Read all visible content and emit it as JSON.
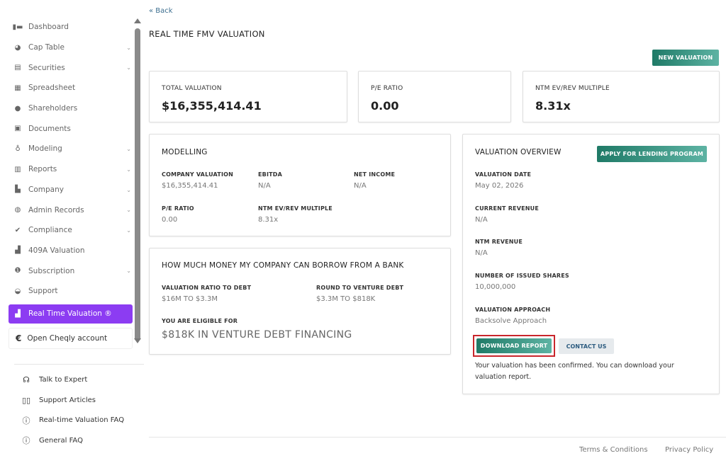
{
  "sidebar": {
    "items": [
      {
        "label": "Dashboard",
        "icon": "dashboard-icon",
        "chevron": false
      },
      {
        "label": "Cap Table",
        "icon": "pie-chart-icon",
        "chevron": true
      },
      {
        "label": "Securities",
        "icon": "clipboard-icon",
        "chevron": true
      },
      {
        "label": "Spreadsheet",
        "icon": "spreadsheet-icon",
        "chevron": false
      },
      {
        "label": "Shareholders",
        "icon": "person-icon",
        "chevron": false
      },
      {
        "label": "Documents",
        "icon": "folder-icon",
        "chevron": false
      },
      {
        "label": "Modeling",
        "icon": "lightbulb-icon",
        "chevron": true
      },
      {
        "label": "Reports",
        "icon": "report-icon",
        "chevron": true
      },
      {
        "label": "Company",
        "icon": "building-icon",
        "chevron": true
      },
      {
        "label": "Admin Records",
        "icon": "records-icon",
        "chevron": true
      },
      {
        "label": "Compliance",
        "icon": "check-badge-icon",
        "chevron": true
      },
      {
        "label": "409A Valuation",
        "icon": "bar-chart-icon",
        "chevron": false
      },
      {
        "label": "Subscription",
        "icon": "dollar-icon",
        "chevron": true
      },
      {
        "label": "Support",
        "icon": "support-icon",
        "chevron": false
      }
    ],
    "active_item": {
      "label": "Real Time Valuation ®",
      "icon": "bar-chart-icon"
    },
    "open_account": {
      "label": "Open Cheqly account",
      "icon": "cheqly-logo-icon"
    },
    "help": [
      {
        "label": "Talk to Expert",
        "icon": "headset-icon"
      },
      {
        "label": "Support Articles",
        "icon": "book-icon"
      },
      {
        "label": "Real-time Valuation FAQ",
        "icon": "question-icon"
      },
      {
        "label": "General FAQ",
        "icon": "question-icon"
      }
    ]
  },
  "main": {
    "back_label": "« Back",
    "page_title": "REAL TIME FMV VALUATION",
    "new_valuation_label": "NEW VALUATION",
    "stats": [
      {
        "label": "TOTAL VALUATION",
        "value": "$16,355,414.41"
      },
      {
        "label": "P/E RATIO",
        "value": "0.00"
      },
      {
        "label": "NTM EV/REV MULTIPLE",
        "value": "8.31x"
      }
    ],
    "modelling": {
      "title": "MODELLING",
      "fields": [
        {
          "label": "COMPANY VALUATION",
          "value": "$16,355,414.41"
        },
        {
          "label": "EBITDA",
          "value": "N/A"
        },
        {
          "label": "NET INCOME",
          "value": "N/A"
        },
        {
          "label": "P/E RATIO",
          "value": "0.00"
        },
        {
          "label": "NTM EV/REV MULTIPLE",
          "value": "8.31x"
        }
      ]
    },
    "borrow": {
      "title": "HOW MUCH MONEY MY COMPANY CAN BORROW FROM A BANK",
      "fields": [
        {
          "label": "VALUATION RATIO TO DEBT",
          "value": "$16M TO $3.3M"
        },
        {
          "label": "ROUND TO VENTURE DEBT",
          "value": "$3.3M TO $818K"
        }
      ],
      "eligible_label": "YOU ARE ELIGIBLE FOR",
      "eligible_value": "$818K IN VENTURE DEBT FINANCING"
    },
    "overview": {
      "title": "VALUATION OVERVIEW",
      "apply_label": "APPLY FOR LENDING PROGRAM",
      "fields": [
        {
          "label": "VALUATION DATE",
          "value": "May 02, 2026"
        },
        {
          "label": "CURRENT REVENUE",
          "value": "N/A"
        },
        {
          "label": "NTM REVENUE",
          "value": "N/A"
        },
        {
          "label": "NUMBER OF ISSUED SHARES",
          "value": "10,000,000"
        },
        {
          "label": "VALUATION APPROACH",
          "value": "Backsolve Approach"
        }
      ],
      "download_label": "DOWNLOAD REPORT",
      "contact_label": "CONTACT US",
      "confirm_text": "Your valuation has been confirmed. You can download your valuation report."
    }
  },
  "footer": {
    "terms_label": "Terms & Conditions",
    "privacy_label": "Privacy Policy"
  },
  "colors": {
    "accent_purple": "#8c3cf2",
    "teal_start": "#1f7a67",
    "teal_end": "#5db3a3",
    "highlight_red": "#c8262c",
    "link_blue": "#3c6e8f"
  }
}
